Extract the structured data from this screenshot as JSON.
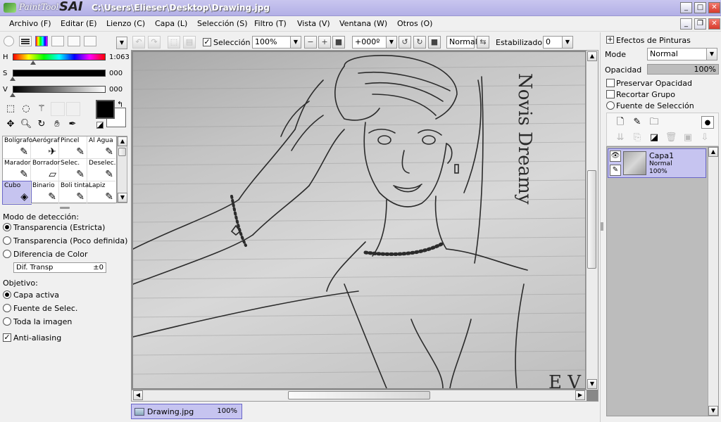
{
  "window": {
    "app_name_part1": "PaintTool",
    "app_name_part2": "SAI",
    "title": "C:\\Users\\Elieser\\Desktop\\Drawing.jpg"
  },
  "menu": [
    "Archivo (F)",
    "Editar (E)",
    "Lienzo (C)",
    "Capa (L)",
    "Selección (S)",
    "Filtro (T)",
    "Vista (V)",
    "Ventana (W)",
    "Otros (O)"
  ],
  "color": {
    "h_label": "H",
    "h_value": "1:063",
    "s_label": "S",
    "s_value": "000",
    "v_label": "V",
    "v_value": "000",
    "primary": "#000000",
    "secondary": "#ffffff"
  },
  "tools": [
    {
      "label": "Bolígrafo",
      "icon": "✎"
    },
    {
      "label": "Aerógraf",
      "icon": "✈"
    },
    {
      "label": "Pincel",
      "icon": "✎"
    },
    {
      "label": "Al Agua",
      "icon": "✎"
    },
    {
      "label": "Marador",
      "icon": "✎"
    },
    {
      "label": "Borrador",
      "icon": "▱"
    },
    {
      "label": "Selec.",
      "icon": "✎"
    },
    {
      "label": "Deselec.",
      "icon": "✎"
    },
    {
      "label": "Cubo",
      "icon": "◈"
    },
    {
      "label": "Binario",
      "icon": "✎"
    },
    {
      "label": "Boli tinta",
      "icon": "✎"
    },
    {
      "label": "Lapiz",
      "icon": "✎"
    }
  ],
  "detection": {
    "heading": "Modo de detección:",
    "options": [
      "Transparencia (Estricta)",
      "Transparencia (Poco definida)",
      "Diferencia de Color"
    ],
    "selected": 0,
    "field_label": "Dif. Transp",
    "field_value": "±0"
  },
  "target": {
    "heading": "Objetivo:",
    "options": [
      "Capa activa",
      "Fuente de Selec.",
      "Toda la imagen"
    ],
    "selected": 0,
    "antialias_label": "Anti-aliasing",
    "antialias_checked": true
  },
  "toolbar": {
    "selection_label": "Selección",
    "selection_checked": true,
    "zoom": "100%",
    "rotation": "+000º",
    "blend_mode": "Normal",
    "stabilizer_label": "Estabilizador",
    "stabilizer_value": "0"
  },
  "document": {
    "tab_name": "Drawing.jpg",
    "tab_zoom": "100%"
  },
  "drawing_text": {
    "vertical_text": "Novis Dreamy",
    "corner_text": "E V"
  },
  "layers_panel": {
    "effects_label": "Efectos de Pinturas",
    "mode_label": "Mode",
    "mode_value": "Normal",
    "opacity_label": "Opacidad",
    "opacity_value": "100%",
    "opacity_fraction": 1.0,
    "preserve_opacity_label": "Preservar Opacidad",
    "clip_group_label": "Recortar Grupo",
    "selection_source_label": "Fuente de Selección",
    "layers": [
      {
        "name": "Capa1",
        "mode": "Normal",
        "opacity": "100%"
      }
    ]
  }
}
